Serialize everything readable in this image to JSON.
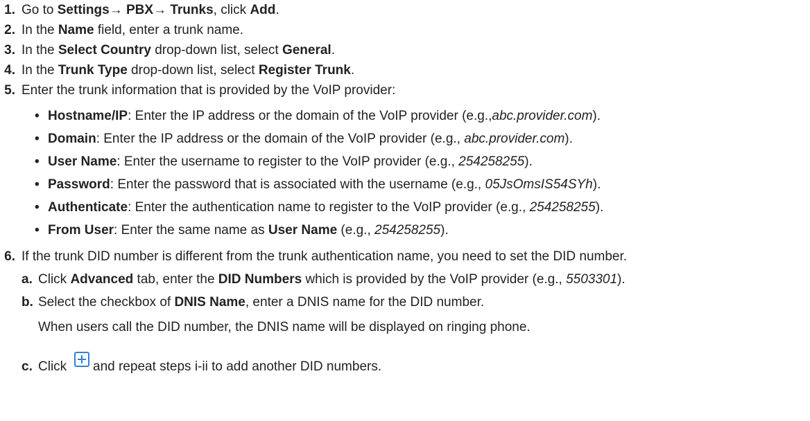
{
  "steps": {
    "s1": {
      "num": "1.",
      "t1": "Go to ",
      "b1": "Settings",
      "t2": "→ ",
      "b2": "PBX",
      "t3": "→ ",
      "b3": "Trunks",
      "t4": ", click ",
      "b4": "Add",
      "t5": "."
    },
    "s2": {
      "num": "2.",
      "t1": "In the ",
      "b1": "Name",
      "t2": " field, enter a trunk name."
    },
    "s3": {
      "num": "3.",
      "t1": "In the ",
      "b1": "Select Country",
      "t2": " drop-down list, select ",
      "b2": "General",
      "t3": "."
    },
    "s4": {
      "num": "4.",
      "t1": "In the ",
      "b1": "Trunk Type",
      "t2": " drop-down list, select ",
      "b2": "Register Trunk",
      "t3": "."
    },
    "s5": {
      "num": "5.",
      "text": "Enter the trunk information that is provided by the VoIP provider:"
    },
    "s6": {
      "num": "6.",
      "text": "If the trunk DID number is different from the trunk authentication name, you need to set the DID number."
    }
  },
  "bullets": [
    {
      "label": "Hostname/IP",
      "text": ": Enter the IP address or the domain of the VoIP provider (e.g.,",
      "example": "abc.provider.com",
      "end": ")."
    },
    {
      "label": "Domain",
      "text": ": Enter the IP address or the domain of the VoIP provider (e.g., ",
      "example": "abc.provider.com",
      "end": ")."
    },
    {
      "label": "User Name",
      "text": ": Enter the username to register to the VoIP provider (e.g., ",
      "example": "254258255",
      "end": ")."
    },
    {
      "label": "Password",
      "text": ": Enter the password that is associated with the username (e.g., ",
      "example": "05JsOmsIS54SYh",
      "end": ")."
    },
    {
      "label": "Authenticate",
      "text": ": Enter the authentication name to register to the VoIP provider (e.g., ",
      "example": "254258255",
      "end": ")."
    },
    {
      "label": "From User",
      "text": ": Enter the same name as ",
      "bold2": "User Name",
      "text2": " (e.g., ",
      "example": "254258255",
      "end": ")."
    }
  ],
  "substeps": {
    "a": {
      "letter": "a.",
      "t1": "Click ",
      "b1": "Advanced",
      "t2": " tab, enter the ",
      "b2": "DID Numbers",
      "t3": " which is provided by the VoIP provider (e.g., ",
      "ex": "5503301",
      "t4": ")."
    },
    "b": {
      "letter": "b.",
      "t1": "Select the checkbox of ",
      "b1": "DNIS Name",
      "t2": ", enter a DNIS name for the DID number.",
      "note": "When users call the DID number, the DNIS name will be displayed on ringing phone."
    },
    "c": {
      "letter": "c.",
      "t1": "Click ",
      "t2": " and repeat steps i-ii to add another DID numbers."
    }
  },
  "bullet_char": "•",
  "icons": {
    "add": "plus-box-icon",
    "accent": "#2e82d6"
  }
}
